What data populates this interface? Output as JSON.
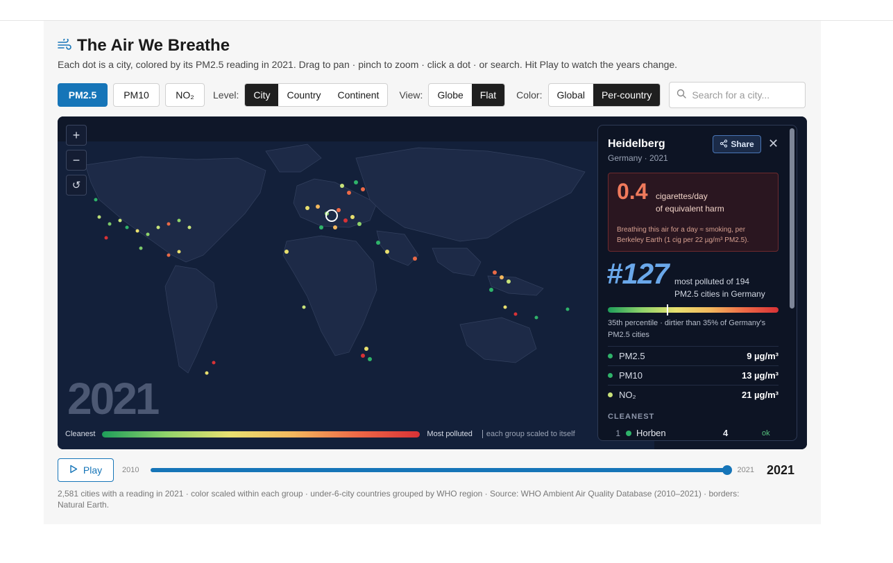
{
  "header": {
    "title": "The Air We Breathe",
    "subtitle": "Each dot is a city, colored by its PM2.5 reading in 2021. Drag to pan · pinch to zoom · click a dot · or search. Hit Play to watch the years change."
  },
  "pollutants": [
    {
      "label": "PM2.5",
      "active": true
    },
    {
      "label": "PM10",
      "active": false
    },
    {
      "label": "NO₂",
      "active": false
    }
  ],
  "level": {
    "label": "Level:",
    "options": [
      "City",
      "Country",
      "Continent"
    ],
    "selected": "City"
  },
  "view": {
    "label": "View:",
    "options": [
      "Globe",
      "Flat"
    ],
    "selected": "Flat"
  },
  "color": {
    "label": "Color:",
    "options": [
      "Global",
      "Per-country"
    ],
    "selected": "Per-country"
  },
  "search": {
    "placeholder": "Search for a city..."
  },
  "map": {
    "year_overlay": "2021",
    "legend_left": "Cleanest",
    "legend_right": "Most polluted",
    "legend_note": "each group scaled to itself",
    "zoom_in": "+",
    "zoom_out": "−",
    "reset": "↺"
  },
  "panel": {
    "city": "Heidelberg",
    "subtitle": "Germany · 2021",
    "share_label": "Share",
    "close": "✕",
    "harm_value": "0.4",
    "harm_unit_1": "cigarettes/day",
    "harm_unit_2": "of equivalent harm",
    "harm_note": "Breathing this air for a day ≈ smoking, per Berkeley Earth (1 cig per 22 µg/m³ PM2.5).",
    "rank": "#127",
    "rank_desc_1": "most polluted of 194",
    "rank_desc_2": "PM2.5 cities in Germany",
    "percentile": 0.35,
    "percentile_text": "35th percentile · dirtier than 35% of Germany's PM2.5 cities",
    "metrics": [
      {
        "name": "PM2.5",
        "value": "9 µg/m³",
        "color": "#2fb36a"
      },
      {
        "name": "PM10",
        "value": "13 µg/m³",
        "color": "#2fb36a"
      },
      {
        "name": "NO₂",
        "value": "21 µg/m³",
        "color": "#c9e27a"
      }
    ],
    "cleanest_label": "CLEANEST",
    "cleanest_row": {
      "rank": "1",
      "city": "Horben",
      "value": "4",
      "status": "ok",
      "color": "#2fb36a"
    }
  },
  "timeline": {
    "play_label": "Play",
    "start_year": "2010",
    "end_year": "2021",
    "current_year": "2021",
    "progress": 1.0
  },
  "footer": "2,581 cities with a reading in 2021 · color scaled within each group · under-6-city countries grouped by WHO region · Source: WHO Ambient Air Quality Database (2010–2021) · borders: Natural Earth.",
  "colors": {
    "accent": "#1675b8",
    "map_bg": "#0f1729",
    "land": "#1d2a47"
  }
}
